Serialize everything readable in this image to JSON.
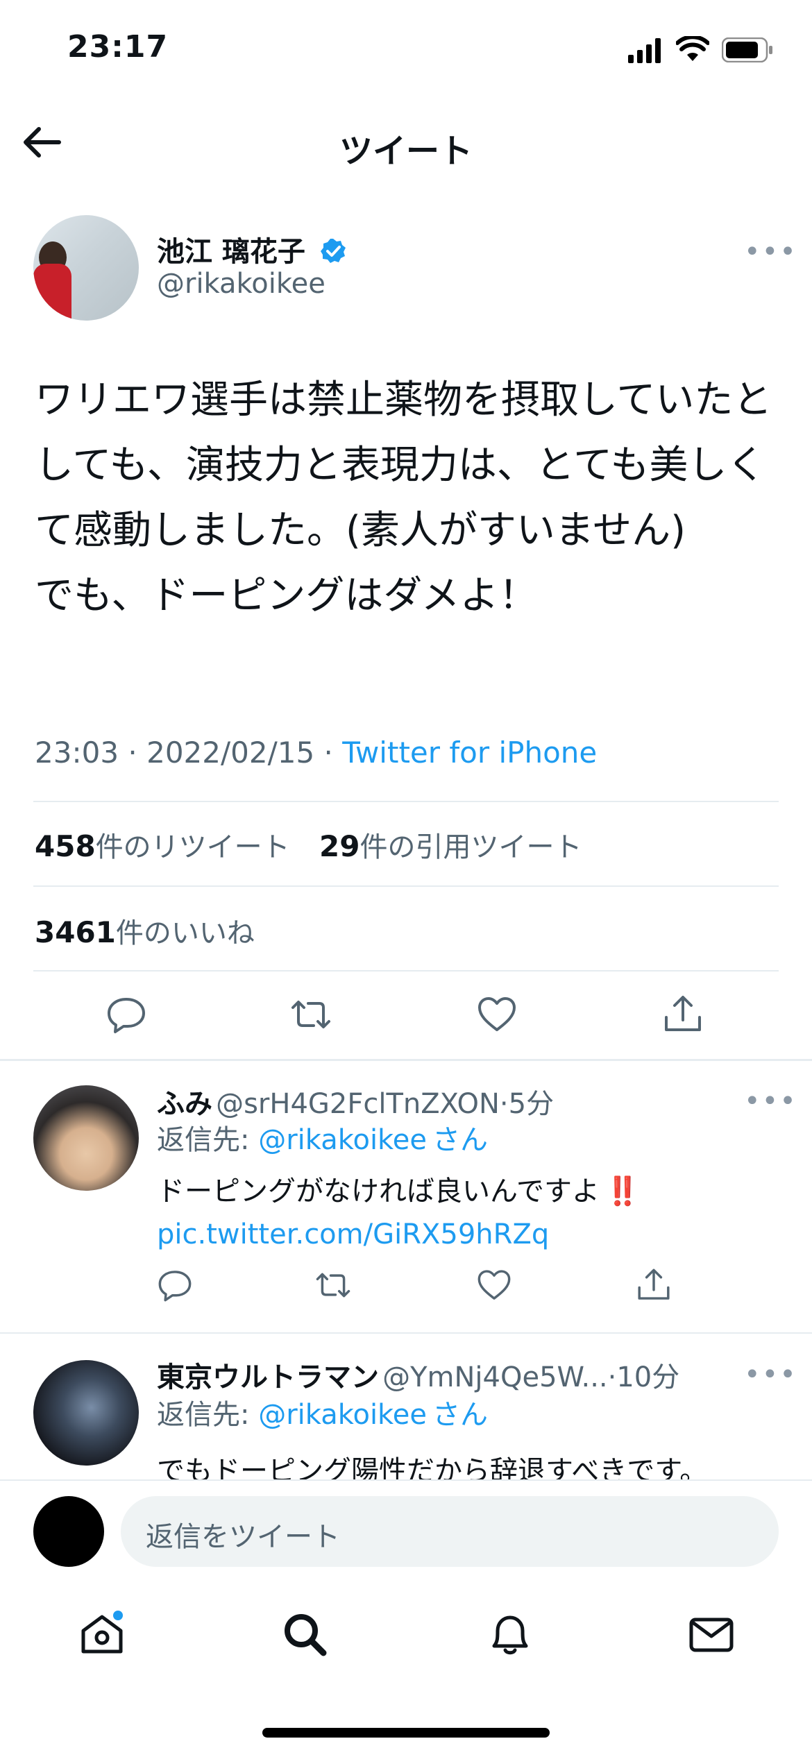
{
  "status_bar": {
    "time": "23:17"
  },
  "header": {
    "title": "ツイート",
    "back_icon": "arrow-left-icon"
  },
  "tweet": {
    "author_name": "池江 璃花子",
    "author_handle": "@rikakoikee",
    "verified": true,
    "text": "ワリエワ選手は禁止薬物を摂取していたとしても、演技力と表現力は、とても美しくて感動しました。(素人がすいません)\nでも、ドーピングはダメよ！",
    "time": "23:03",
    "date": "2022/02/15",
    "source": "Twitter for iPhone",
    "retweets_count": "458",
    "retweets_label": "件のリツイート",
    "quotes_count": "29",
    "quotes_label": "件の引用ツイート",
    "likes_count": "3461",
    "likes_label": "件のいいね"
  },
  "replies": [
    {
      "name": "ふみ",
      "handle": "@srH4G2FclTnZXON",
      "time": "5分",
      "reply_to_prefix": "返信先: ",
      "reply_to_handle": "@rikakoikee",
      "reply_to_suffix": "さん",
      "text": "ドーピングがなければ良いんですよ",
      "emoji": "‼️",
      "link": "pic.twitter.com/GiRX59hRZq"
    },
    {
      "name": "東京ウルトラマン",
      "handle": "@YmNj4Qe5W...",
      "time": "10分",
      "reply_to_prefix": "返信先: ",
      "reply_to_handle": "@rikakoikee",
      "reply_to_suffix": "さん",
      "text": "でもドーピング陽性だから辞退すべきです。"
    }
  ],
  "compose": {
    "placeholder": "返信をツイート"
  },
  "colors": {
    "accent": "#1d9bf0",
    "muted": "#536471",
    "divider": "#e6ecf0"
  }
}
